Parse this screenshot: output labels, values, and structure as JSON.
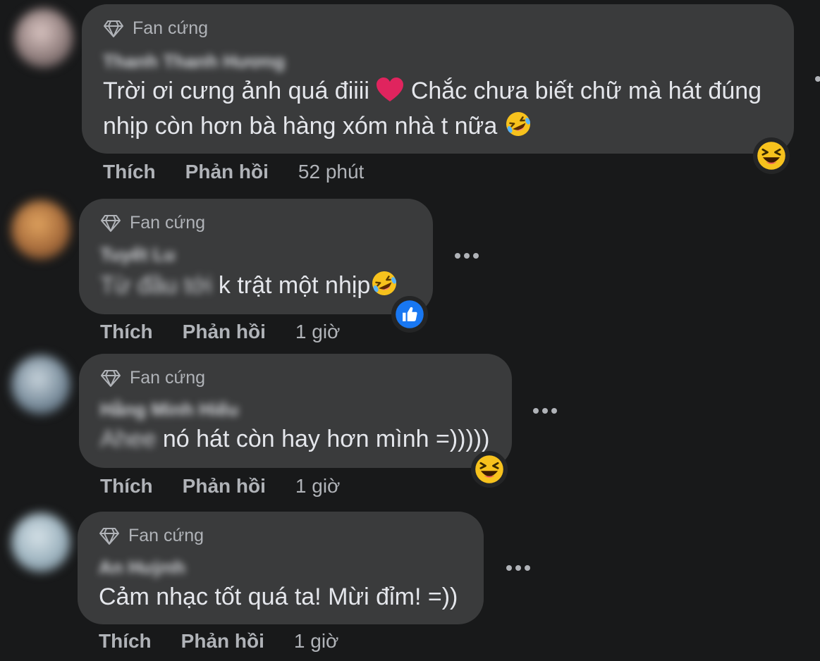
{
  "comments": [
    {
      "badge": "Fan cứng",
      "author": "Thanh Thanh Hương",
      "text_line1": "Trời ơi cưng ảnh quá điiii",
      "text_line1b": " Chắc chưa biết chữ mà hát đúng",
      "text_line2": "nhịp còn hơn bà hàng xóm nhà t nữa",
      "like": "Thích",
      "reply": "Phản hồi",
      "time": "52 phút",
      "reaction": "haha"
    },
    {
      "badge": "Fan cứng",
      "author": "Tuyết Lu",
      "text_hidden": "Từ đầu tới",
      "text": "k trật một nhịp",
      "like": "Thích",
      "reply": "Phản hồi",
      "time": "1 giờ",
      "reaction": "like"
    },
    {
      "badge": "Fan cứng",
      "author": "Hằng Minh Hiếu",
      "text_hidden": "Ahee",
      "text": "nó hát còn hay hơn mình =)))))",
      "like": "Thích",
      "reply": "Phản hồi",
      "time": "1 giờ",
      "reaction": "haha"
    },
    {
      "badge": "Fan cứng",
      "author": "An Huỳnh",
      "text": "Cảm nhạc tốt quá ta! Mừi đỉm! =))",
      "like": "Thích",
      "reply": "Phản hồi",
      "time": "1 giờ"
    }
  ],
  "colors": {
    "background": "#18191a",
    "bubble": "#3a3b3c",
    "secondary_text": "#b0b3b8",
    "like_blue": "#1877f2",
    "haha_yellow": "#f7c21d",
    "heart_red": "#e0245e"
  },
  "icons": [
    "diamond-icon",
    "heart-emoji",
    "rofl-emoji",
    "haha-reaction-icon",
    "like-reaction-icon",
    "more-options-icon"
  ]
}
